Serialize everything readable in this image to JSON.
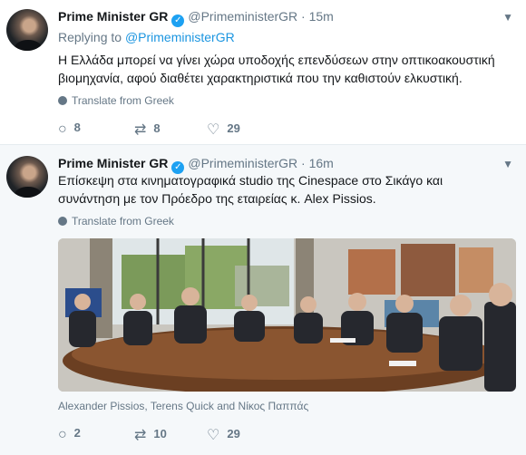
{
  "tweet1": {
    "author_name": "Prime Minister GR",
    "handle": "@PrimeministerGR",
    "time": "15m",
    "replying_prefix": "Replying to",
    "replying_handle": "@PrimeministerGR",
    "text_line1": "Η Ελλάδα μπορεί να γίνει χώρα υποδοχής επενδύσεων στην οπτικοακουστική",
    "text_line2": "βιομηχανία, αφού διαθέτει χαρακτηριστικά που την καθιστούν ελκυστική.",
    "translate_label": "Translate from Greek",
    "replies": "8",
    "retweets": "8",
    "likes": "29"
  },
  "tweet2": {
    "author_name": "Prime Minister GR",
    "handle": "@PrimeministerGR",
    "time": "16m",
    "text_line1": "Επίσκεψη στα κινηματογραφικά studio της Cinespace στο Σικάγο και",
    "text_line2": "συνάντηση με τον Πρόεδρο της εταιρείας κ. Alex Pissios.",
    "translate_label": "Translate from Greek",
    "photo_caption": "Alexander Pissios, Terens Quick and Νίκος Παππάς",
    "replies": "2",
    "retweets": "10",
    "likes": "29"
  },
  "icons": {
    "reply": "reply-icon",
    "retweet": "retweet-icon",
    "like": "heart-icon",
    "verified": "verified-badge-icon",
    "more": "chevron-down-icon",
    "translate": "globe-icon"
  },
  "colors": {
    "link": "#1b95e0",
    "muted": "#657786",
    "verified": "#1da1f2"
  }
}
